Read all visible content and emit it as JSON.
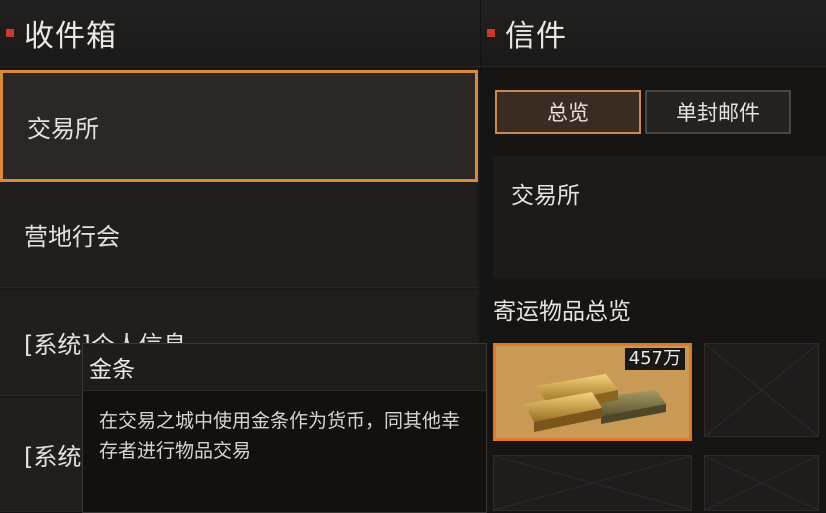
{
  "inbox": {
    "title": "收件箱",
    "items": [
      {
        "label": "交易所"
      },
      {
        "label": "营地行会"
      },
      {
        "label": "[系统]个人信息"
      },
      {
        "label": "[系统]"
      }
    ]
  },
  "mail": {
    "title": "信件",
    "tabs": [
      {
        "label": "总览"
      },
      {
        "label": "单封邮件"
      }
    ],
    "sender": "交易所",
    "section_title": "寄运物品总览",
    "slots": [
      {
        "item": "金条",
        "quantity": "457万",
        "icon": "gold-bars-icon"
      }
    ]
  },
  "tooltip": {
    "title": "金条",
    "description": "在交易之城中使用金条作为货币，同其他幸存者进行物品交易"
  },
  "colors": {
    "accent": "#d98a3c",
    "header_mark": "#c83a2a",
    "slot_border": "#e0772a"
  }
}
